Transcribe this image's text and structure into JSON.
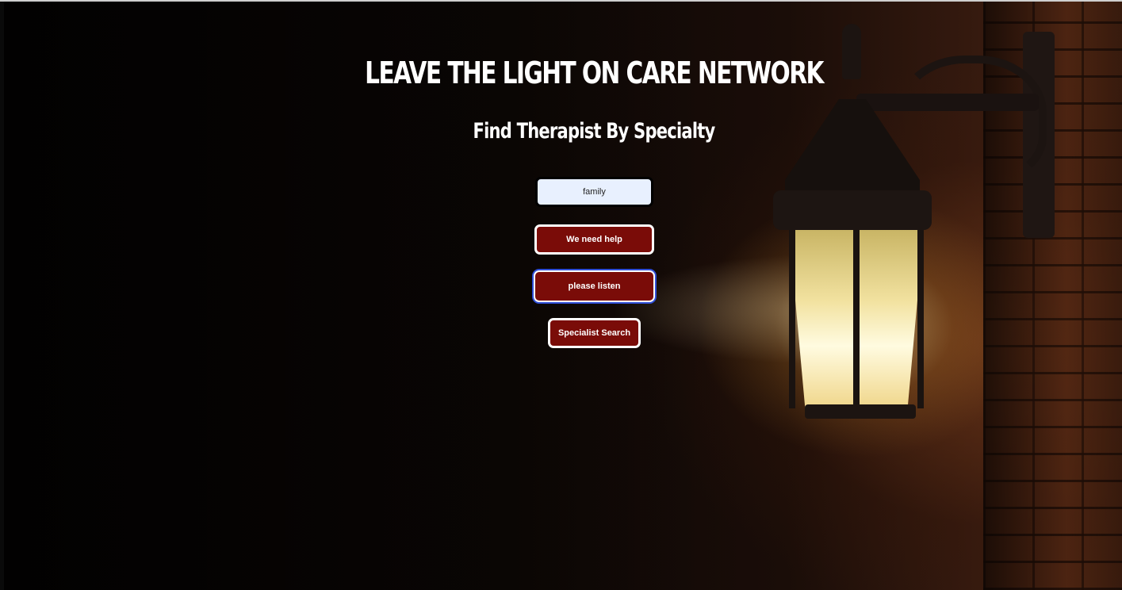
{
  "header": {
    "title": "LEAVE THE LIGHT ON CARE NETWORK",
    "subtitle": "Find Therapist By Specialty"
  },
  "form": {
    "specialty_value": "family",
    "help_button_label": "We need help",
    "listen_button_label": "please listen",
    "search_button_label": "Specialist Search"
  },
  "colors": {
    "button_background": "#7a0c08",
    "input_background": "#e8f0fe",
    "focus_ring": "#2f4fd8",
    "text": "#ffffff"
  },
  "background": {
    "image_subject": "lantern-on-brick-wall"
  }
}
